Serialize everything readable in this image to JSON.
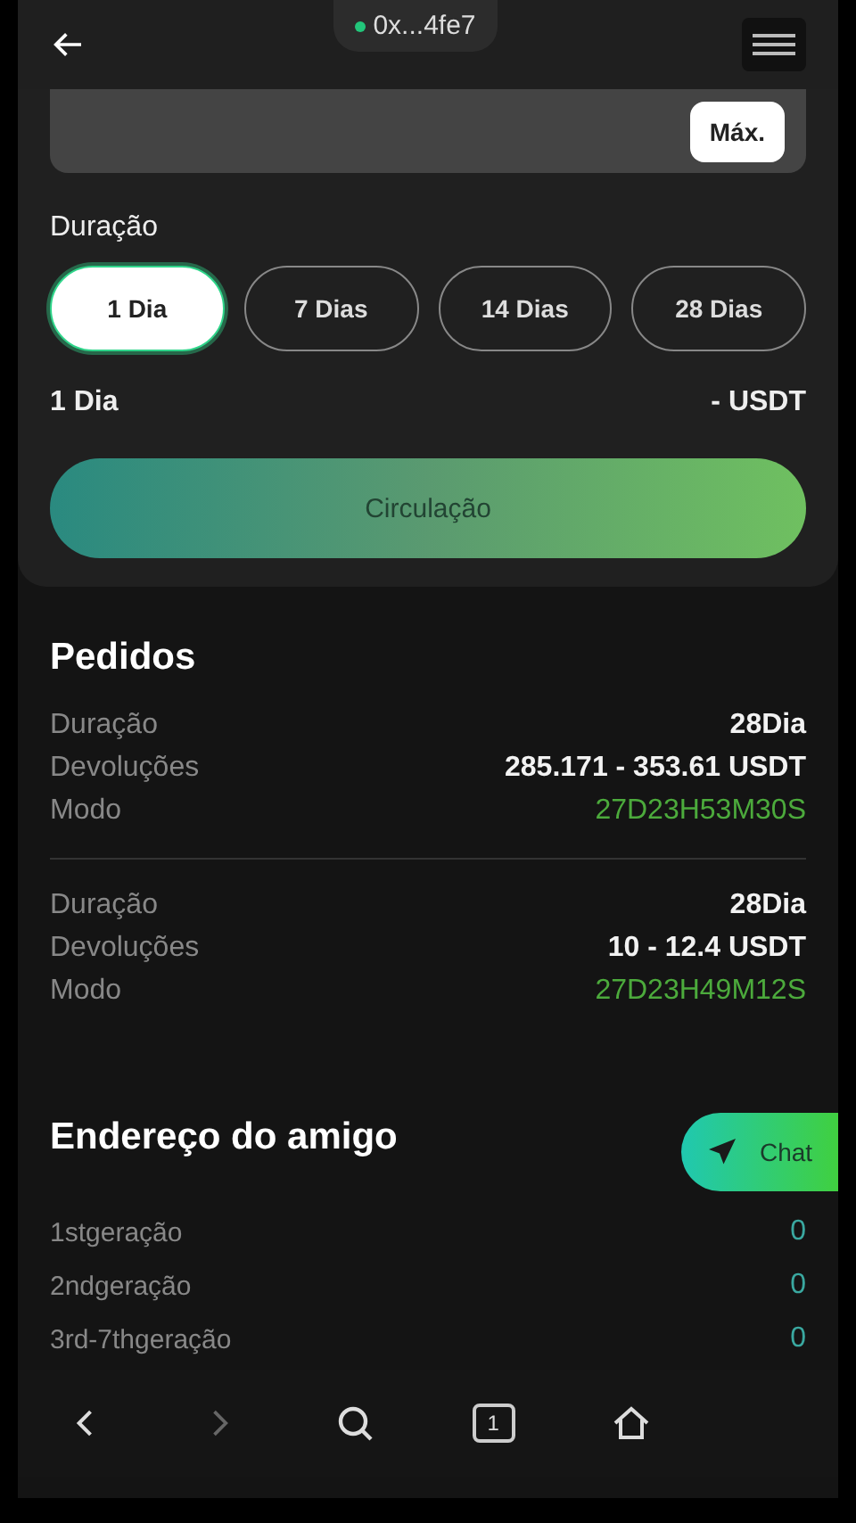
{
  "header": {
    "wallet": "0x...4fe7"
  },
  "amount": {
    "max_button": "Máx."
  },
  "duration": {
    "label": "Duração",
    "options": [
      {
        "label": "1 Dia",
        "selected": true
      },
      {
        "label": "7 Dias",
        "selected": false
      },
      {
        "label": "14 Dias",
        "selected": false
      },
      {
        "label": "28 Dias",
        "selected": false
      }
    ],
    "summary_left": "1 Dia",
    "summary_right": "- USDT",
    "button": "Circulação"
  },
  "orders": {
    "title": "Pedidos",
    "items": [
      {
        "rows": [
          {
            "label": "Duração",
            "value": "28Dia",
            "kind": "plain"
          },
          {
            "label": "Devoluções",
            "value": "285.171 - 353.61 USDT",
            "kind": "plain"
          },
          {
            "label": "Modo",
            "value": "27D23H53M30S",
            "kind": "timer"
          }
        ]
      },
      {
        "rows": [
          {
            "label": "Duração",
            "value": "28Dia",
            "kind": "plain"
          },
          {
            "label": "Devoluções",
            "value": "10 - 12.4 USDT",
            "kind": "plain"
          },
          {
            "label": "Modo",
            "value": "27D23H49M12S",
            "kind": "timer"
          }
        ]
      }
    ]
  },
  "friends": {
    "title": "Endereço do amigo",
    "rows": [
      {
        "label": "1stgeração",
        "value": "0"
      },
      {
        "label": "2ndgeração",
        "value": "0"
      },
      {
        "label": "3rd-7thgeração",
        "value": "0"
      }
    ]
  },
  "chat_button": "Chat",
  "browser_nav": {
    "tab_count": "1"
  }
}
